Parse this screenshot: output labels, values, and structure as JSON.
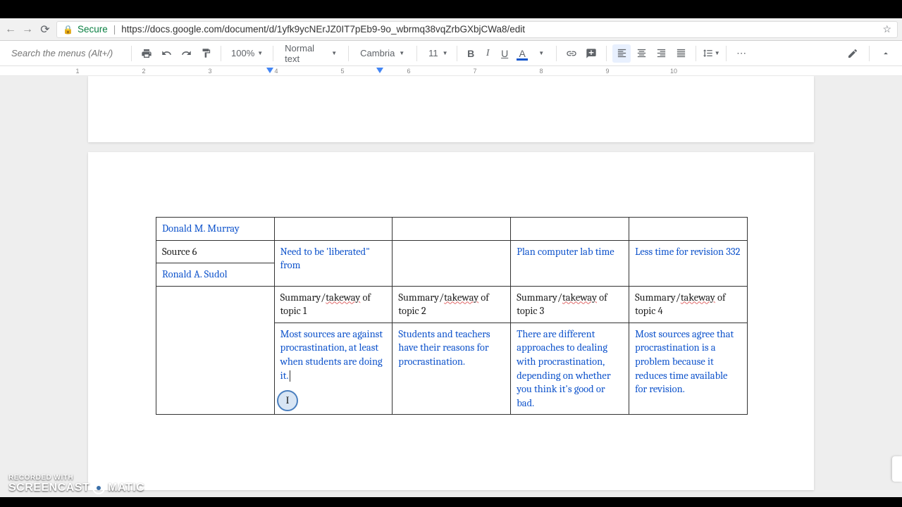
{
  "browser": {
    "secure_label": "Secure",
    "url": "https://docs.google.com/document/d/1yfk9ycNErJZ0IT7pEb9-9o_wbrmq38vqZrbGXbjCWa8/edit"
  },
  "toolbar": {
    "search_placeholder": "Search the menus (Alt+/)",
    "zoom": "100%",
    "styles": "Normal text",
    "font": "Cambria",
    "size": "11"
  },
  "ruler": {
    "numbers": [
      1,
      2,
      3,
      4,
      5,
      6,
      7,
      8,
      9,
      10
    ]
  },
  "table": {
    "r0": {
      "c0": "Donald M. Murray"
    },
    "r1": {
      "c0_line1": "Source 6",
      "c0_line2": "Ronald A. Sudol",
      "c1": "Need to be 'liberated\" from",
      "c3": "Plan computer lab time",
      "c4": "Less time for revision 332"
    },
    "r2": {
      "c1a": "Summary/",
      "c1b": "takeway",
      "c1c": " of topic 1",
      "c2a": "Summary/",
      "c2b": "takeway",
      "c2c": " of topic 2",
      "c3a": "Summary/",
      "c3b": "takeway",
      "c3c": " of topic 3",
      "c4a": "Summary/",
      "c4b": "takeway",
      "c4c": " of topic 4"
    },
    "r3": {
      "c1": "Most sources are against procrastination, at least when students are doing it.",
      "c2": "Students and teachers have their reasons for procrastination.",
      "c3": "There are different approaches to dealing with procrastination, depending on whether you think it's good or bad.",
      "c4": "Most sources agree that procrastination is a problem because it reduces time available for revision."
    }
  },
  "watermark": {
    "line1": "RECORDED WITH",
    "line2a": "SCREENCAST",
    "line2b": "MATIC"
  }
}
